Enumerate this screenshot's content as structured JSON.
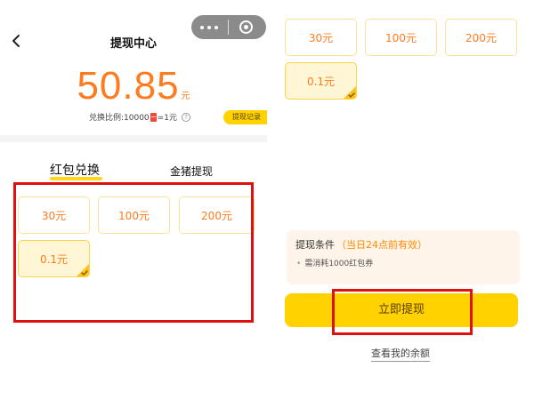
{
  "header": {
    "title": "提现中心"
  },
  "capsule": {
    "more_icon": "more-dots-icon",
    "close_icon": "mini-program-close-icon"
  },
  "balance": {
    "amount": "50.85",
    "unit": "元"
  },
  "ratio": {
    "prefix": "兑换比例:10000",
    "suffix": "=1元"
  },
  "record_button": "提现记录",
  "tabs": [
    {
      "label": "红包兑换",
      "active": true
    },
    {
      "label": "金猪提现",
      "active": false
    }
  ],
  "options": [
    {
      "label": "30元",
      "selected": false
    },
    {
      "label": "100元",
      "selected": false
    },
    {
      "label": "200元",
      "selected": false
    },
    {
      "label": "0.1元",
      "selected": true
    }
  ],
  "condition": {
    "title": "提现条件",
    "note": "（当日24点前有效）",
    "item": "需消耗1000红包券"
  },
  "withdraw_button": "立即提现",
  "balance_link": "查看我的余额",
  "colors": {
    "accent_orange": "#ff7b1f",
    "button_yellow": "#ffd200",
    "highlight_red": "#e01010",
    "condition_bg": "#fff4ea"
  }
}
